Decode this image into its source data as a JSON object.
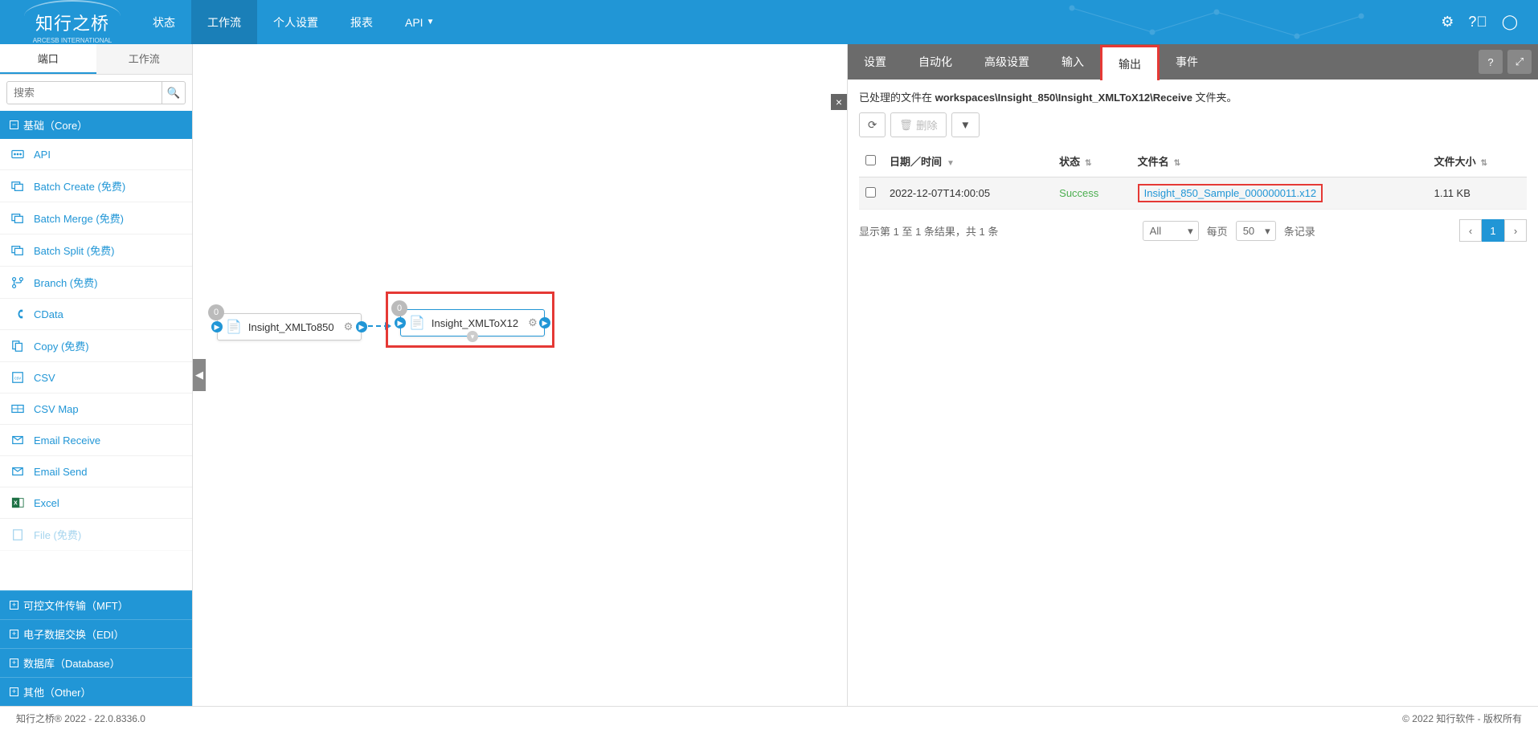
{
  "brand": {
    "name": "知行之桥",
    "sub": "ARCESB INTERNATIONAL"
  },
  "topnav": {
    "items": [
      "状态",
      "工作流",
      "个人设置",
      "报表",
      "API"
    ],
    "activeIndex": 1
  },
  "sidebar": {
    "tabs": [
      "端口",
      "工作流"
    ],
    "activeTab": 0,
    "searchPlaceholder": "搜索",
    "sections": {
      "core": "基础（Core）",
      "mft": "可控文件传输（MFT）",
      "edi": "电子数据交换（EDI）",
      "db": "数据库（Database）",
      "other": "其他（Other）"
    },
    "coreItems": [
      "API",
      "Batch Create (免费)",
      "Batch Merge (免费)",
      "Batch Split (免费)",
      "Branch (免费)",
      "CData",
      "Copy (免费)",
      "CSV",
      "CSV Map",
      "Email Receive",
      "Email Send",
      "Excel",
      "File (免费)"
    ]
  },
  "canvas": {
    "node1": {
      "label": "Insight_XMLTo850",
      "badge": "0"
    },
    "node2": {
      "label": "Insight_XMLToX12",
      "badge": "0"
    }
  },
  "details": {
    "tabs": [
      "设置",
      "自动化",
      "高级设置",
      "输入",
      "输出",
      "事件"
    ],
    "activeIndex": 4,
    "pathPrefix": "已处理的文件在 ",
    "pathBold": "workspaces\\Insight_850\\Insight_XMLToX12\\Receive",
    "pathSuffix": " 文件夹。",
    "buttons": {
      "delete": "删除"
    },
    "columns": {
      "datetime": "日期／时间",
      "status": "状态",
      "filename": "文件名",
      "size": "文件大小"
    },
    "row": {
      "datetime": "2022-12-07T14:00:05",
      "status": "Success",
      "filename": "Insight_850_Sample_000000011.x12",
      "size": "1.11 KB"
    },
    "footer": {
      "summary": "显示第 1 至 1 条结果，共 1 条",
      "filter": "All",
      "perPageLabel": "每页",
      "perPage": "50",
      "records": "条记录",
      "page": "1"
    }
  },
  "footer": {
    "left": "知行之桥® 2022 - 22.0.8336.0",
    "right": "© 2022 知行软件 - 版权所有"
  }
}
